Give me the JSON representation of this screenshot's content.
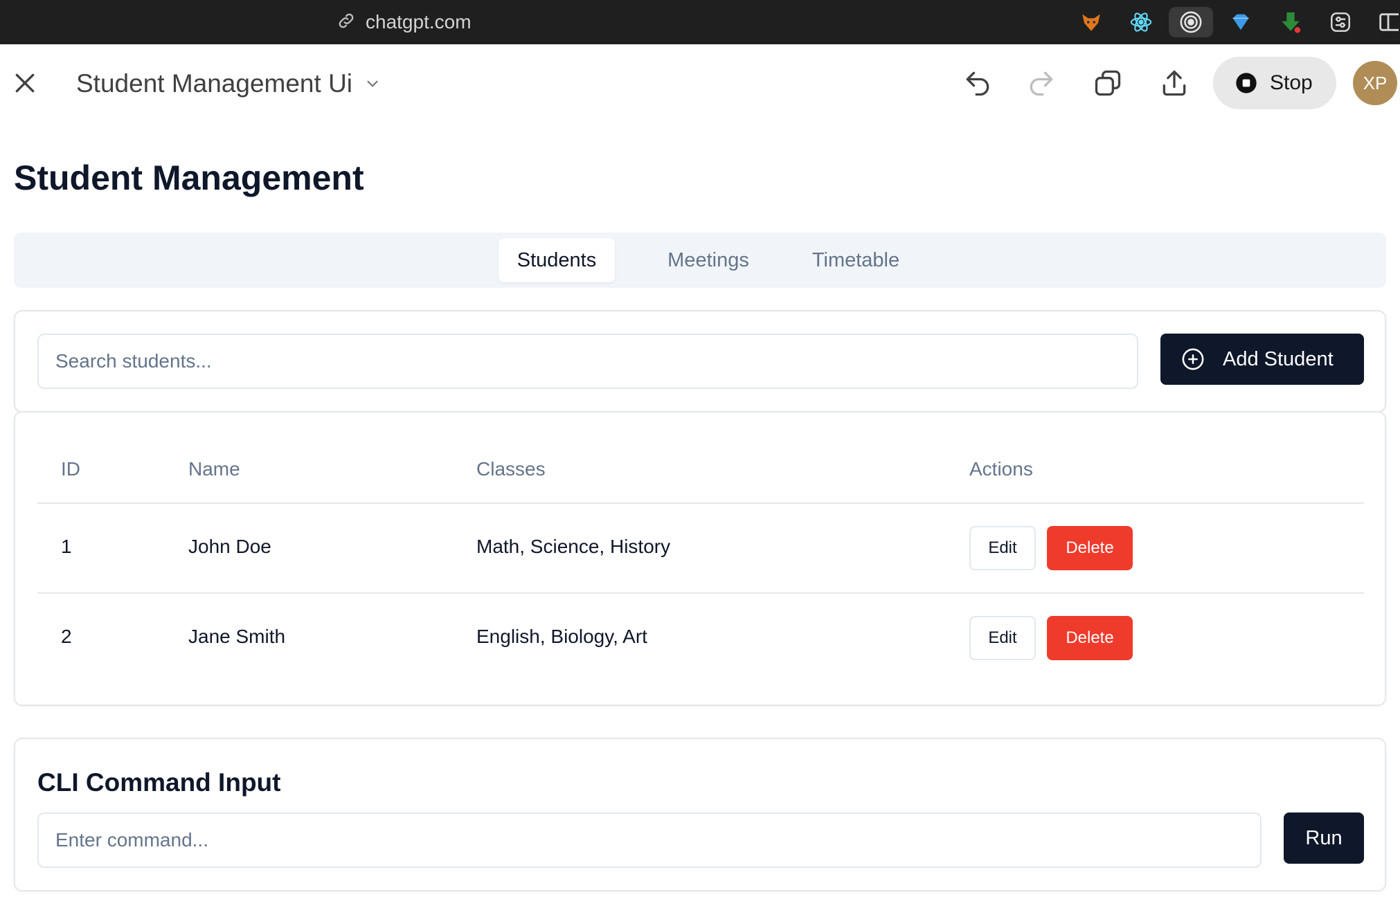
{
  "browser": {
    "url": "chatgpt.com",
    "extensions": [
      "fox-extension-icon",
      "react-devtools-icon",
      "target-extension-icon",
      "diamond-extension-icon",
      "download-arrow-icon",
      "sliders-extension-icon",
      "sidebar-toggle-icon"
    ]
  },
  "header": {
    "title": "Student Management Ui",
    "stop_label": "Stop",
    "avatar_initials": "XP"
  },
  "page": {
    "title": "Student Management"
  },
  "tabs": [
    {
      "label": "Students",
      "active": true
    },
    {
      "label": "Meetings",
      "active": false
    },
    {
      "label": "Timetable",
      "active": false
    }
  ],
  "search": {
    "placeholder": "Search students...",
    "add_label": "Add Student"
  },
  "table": {
    "columns": [
      "ID",
      "Name",
      "Classes",
      "Actions"
    ],
    "rows": [
      {
        "id": "1",
        "name": "John Doe",
        "classes": "Math, Science, History"
      },
      {
        "id": "2",
        "name": "Jane Smith",
        "classes": "English, Biology, Art"
      }
    ],
    "edit_label": "Edit",
    "delete_label": "Delete"
  },
  "cli": {
    "title": "CLI Command Input",
    "placeholder": "Enter command...",
    "run_label": "Run"
  },
  "colors": {
    "primary": "#0f172a",
    "danger": "#ef3b2c",
    "muted": "#64748b",
    "avatar": "#b08d57"
  }
}
